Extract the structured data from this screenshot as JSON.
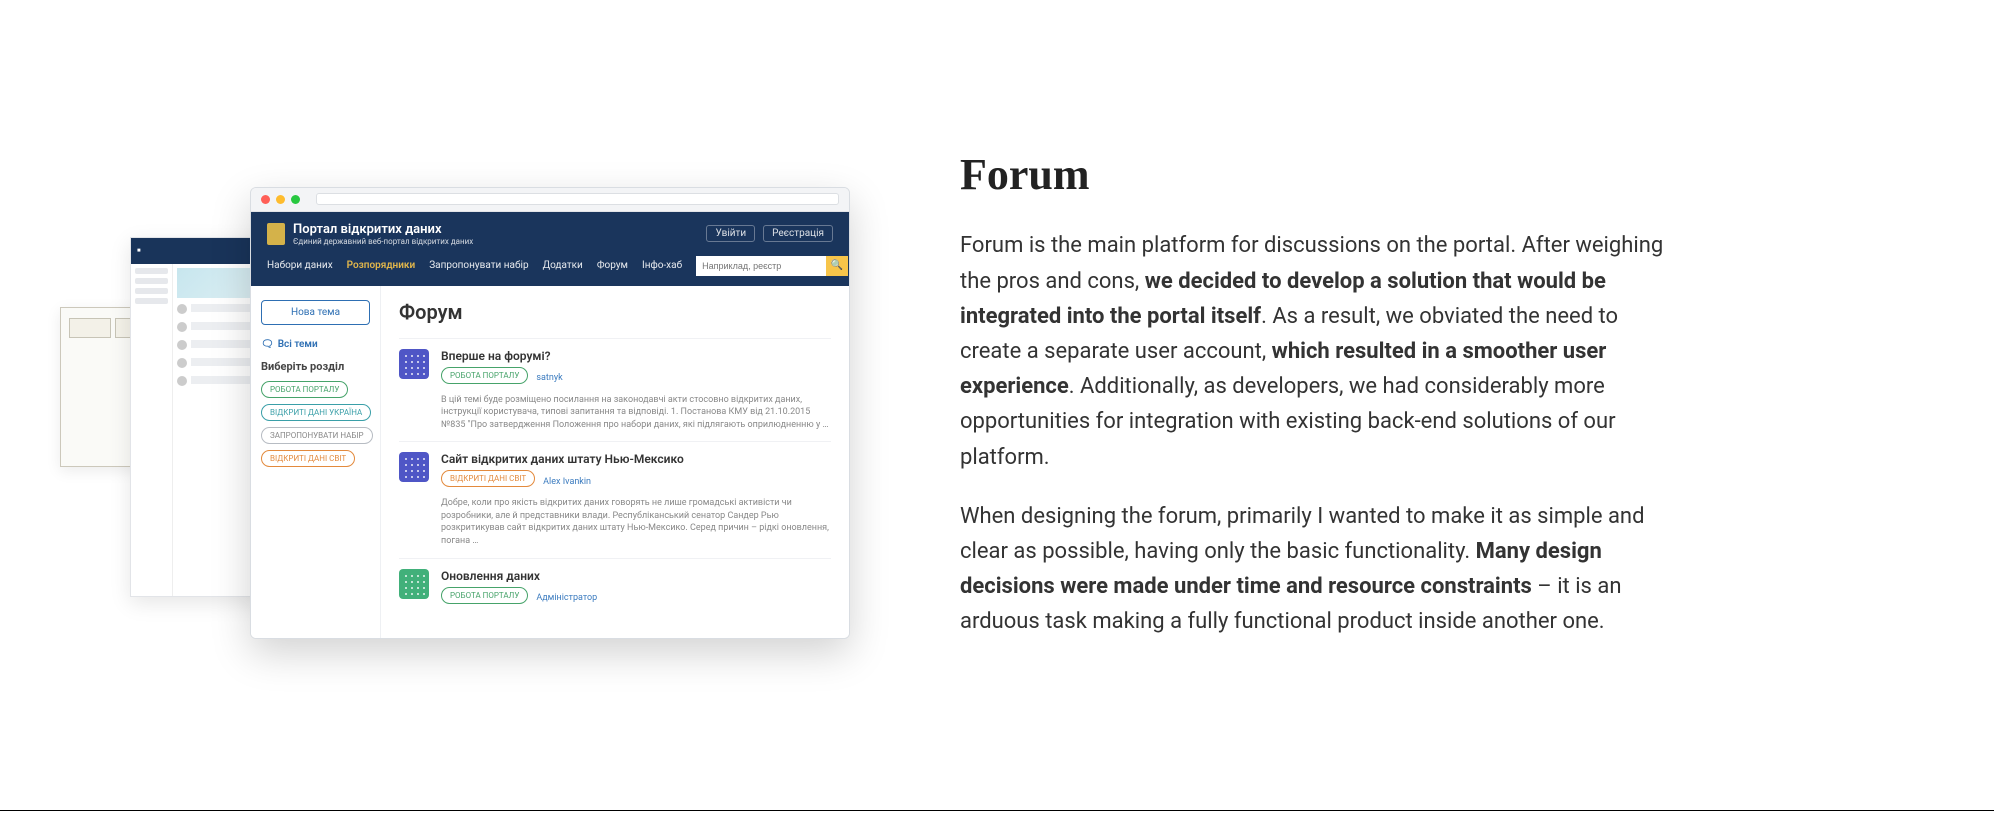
{
  "article": {
    "heading": "Forum",
    "p1_a": "Forum is the main platform for discussions on the portal. After weighing the pros and cons, ",
    "p1_b": "we decided to develop a solution that would be integrated into the portal itself",
    "p1_c": ". As a result, we obviated the need to create a separate user account, ",
    "p1_d": "which resulted in a smoother user experience",
    "p1_e": ". Additionally, as developers, we had considerably more opportunities for integration with existing back-end solutions of our platform.",
    "p2_a": "When designing the forum, primarily I wanted to make it as simple and clear as possible, having only the basic functionality. ",
    "p2_b": "Many design decisions were made under time and resource constraints",
    "p2_c": " – it is an arduous task making a fully functional product inside another one."
  },
  "mockup": {
    "brand_title": "Портал відкритих даних",
    "brand_sub": "Єдиний державний веб-портал відкритих даних",
    "auth": {
      "login": "Увійти",
      "register": "Реєстрація"
    },
    "nav": {
      "datasets": "Набори даних",
      "publishers": "Розпорядники",
      "suggest": "Запропонувати набір",
      "apps": "Додатки",
      "forum": "Форум",
      "infohub": "Інфо-хаб"
    },
    "search_placeholder": "Наприклад, реєстр",
    "sidebar": {
      "new_topic": "Нова тема",
      "all_topics": "Всі теми",
      "section_label": "Виберіть розділ",
      "pill_portal": "РОБОТА ПОРТАЛУ",
      "pill_ua": "ВІДКРИТІ ДАНІ УКРАЇНА",
      "pill_suggest": "ЗАПРОПОНУВАТИ НАБІР",
      "pill_world": "ВІДКРИТІ ДАНІ СВІТ"
    },
    "main": {
      "page_title": "Форум",
      "topics": [
        {
          "title": "Вперше на форумі?",
          "tag": "РОБОТА ПОРТАЛУ",
          "author": "satnyk",
          "desc": "В цій темі буде розміщено посилання на законодавчі акти стосовно відкритих даних, інструкції користувача, типові запитання та відповіді. 1. Постанова КМУ від 21.10.2015 №835 \"Про затвердження Положення про набори даних, які підлягають оприлюдненню у …"
        },
        {
          "title": "Сайт відкритих даних штату Нью-Мексико",
          "tag": "ВІДКРИТІ ДАНІ СВІТ",
          "author": "Alex Ivankin",
          "desc": "Добре, коли про якість відкритих даних говорять не лише громадські активісти чи розробники, але й представники влади. Республіканський сенатор Сандер Рью розкритикував сайт відкритих даних штату Нью-Мексико. Серед причин – рідкі оновлення, погана …"
        },
        {
          "title": "Оновлення даних",
          "tag": "РОБОТА ПОРТАЛУ",
          "author": "Адміністратор",
          "desc": ""
        }
      ]
    }
  }
}
